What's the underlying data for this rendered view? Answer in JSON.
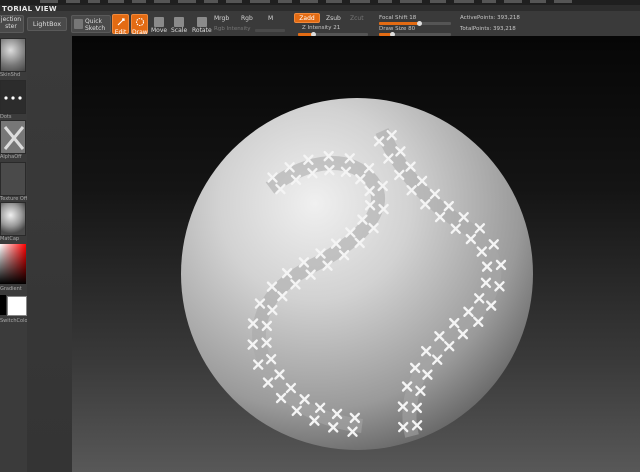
{
  "window": {
    "title": "TORIAL VIEW"
  },
  "toolbar": {
    "projection_master_line1": "jection",
    "projection_master_line2": "ster",
    "lightbox": "LightBox",
    "quick_sketch_line1": "Quick",
    "quick_sketch_line2": "Sketch",
    "edit": "Edit",
    "draw": "Draw",
    "move": "Move",
    "scale": "Scale",
    "rotate": "Rotate",
    "mrgb": "Mrgb",
    "rgb": "Rgb",
    "m": "M",
    "zadd": "Zadd",
    "zsub": "Zsub",
    "zcut": "Zcut",
    "rgb_intensity": "Rgb Intensity",
    "z_intensity": "Z Intensity 21",
    "focal_shift": "Focal Shift 18",
    "draw_size": "Draw Size 80",
    "active_points": "ActivePoints: 393,218",
    "total_points": "TotalPoints: 393,218"
  },
  "left_panel": {
    "tiles": [
      {
        "label": "SkinShd"
      },
      {
        "label": "Dots"
      },
      {
        "label": "AlphaOff"
      },
      {
        "label": "Texture Off"
      },
      {
        "label": "MatCap"
      }
    ],
    "gradient_label": "Gradient",
    "switch_color_label": "SwitchColor"
  },
  "levels": {
    "z_intensity": 0.21,
    "focal_shift": 0.55,
    "draw_size": 0.18
  },
  "colors": {
    "accent": "#e36b13",
    "main_color": "#000000",
    "secondary_color": "#ffffff"
  }
}
